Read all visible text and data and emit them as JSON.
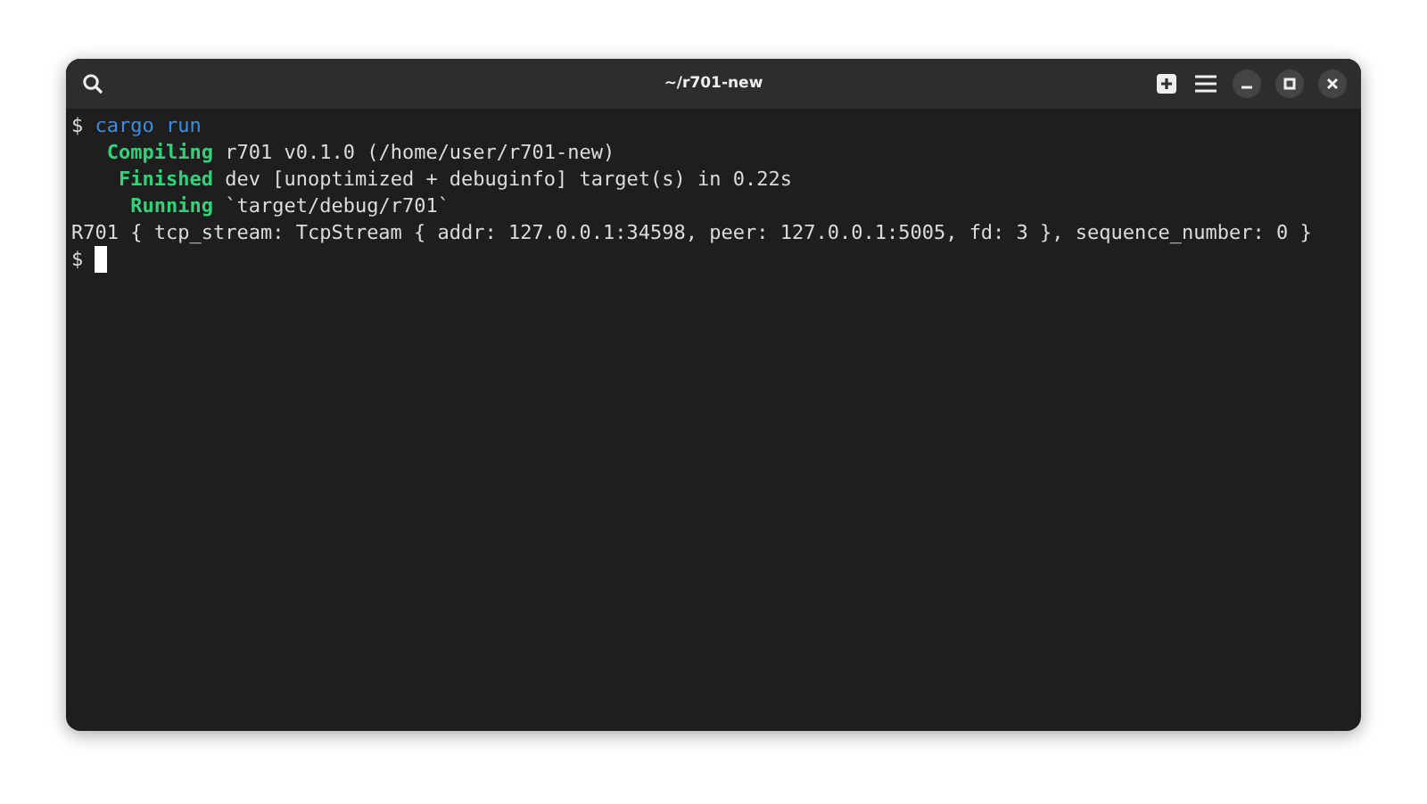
{
  "window": {
    "title": "~/r701-new"
  },
  "terminal": {
    "lines": [
      {
        "segments": [
          {
            "kind": "prompt",
            "text": "$ "
          },
          {
            "kind": "command",
            "text": "cargo run"
          }
        ]
      },
      {
        "segments": [
          {
            "kind": "status",
            "text": "   Compiling"
          },
          {
            "kind": "plain",
            "text": " r701 v0.1.0 (/home/user/r701-new)"
          }
        ]
      },
      {
        "segments": [
          {
            "kind": "status",
            "text": "    Finished"
          },
          {
            "kind": "plain",
            "text": " dev [unoptimized + debuginfo] target(s) in 0.22s"
          }
        ]
      },
      {
        "segments": [
          {
            "kind": "status",
            "text": "     Running"
          },
          {
            "kind": "plain",
            "text": " `target/debug/r701`"
          }
        ]
      },
      {
        "segments": [
          {
            "kind": "plain",
            "text": "R701 { tcp_stream: TcpStream { addr: 127.0.0.1:34598, peer: 127.0.0.1:5005, fd: 3 }, sequence_number: 0 }"
          }
        ]
      },
      {
        "segments": [
          {
            "kind": "prompt",
            "text": "$ "
          }
        ],
        "cursor": true
      }
    ]
  }
}
